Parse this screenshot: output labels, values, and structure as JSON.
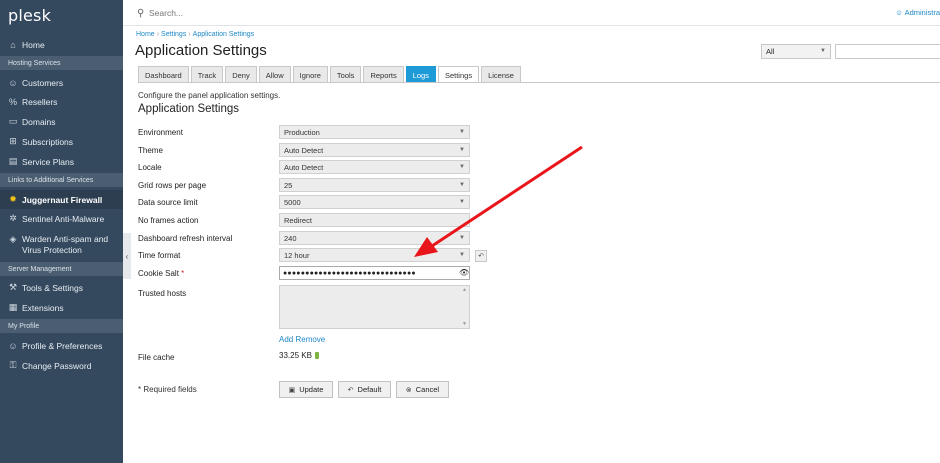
{
  "app": {
    "logo": "plesk"
  },
  "sidebar": {
    "items_top": [
      {
        "label": "Home",
        "icon": "home-icon"
      }
    ],
    "sections": [
      {
        "title": "Hosting Services"
      },
      {
        "title": "Links to Additional Services"
      },
      {
        "title": "Server Management"
      },
      {
        "title": "My Profile"
      }
    ],
    "hosting": [
      {
        "label": "Customers",
        "icon": "user-icon"
      },
      {
        "label": "Resellers",
        "icon": "percent-icon"
      },
      {
        "label": "Domains",
        "icon": "monitor-icon"
      },
      {
        "label": "Subscriptions",
        "icon": "grid-icon"
      },
      {
        "label": "Service Plans",
        "icon": "plans-icon"
      }
    ],
    "links": [
      {
        "label": "Juggernaut Firewall",
        "icon": "firewall-icon"
      },
      {
        "label": "Sentinel Anti-Malware",
        "icon": "gear-icon"
      },
      {
        "label": "Warden Anti-spam and Virus Protection",
        "icon": "shield-icon"
      }
    ],
    "server": [
      {
        "label": "Tools & Settings",
        "icon": "tools-icon"
      },
      {
        "label": "Extensions",
        "icon": "extensions-icon"
      }
    ],
    "profile": [
      {
        "label": "Profile & Preferences",
        "icon": "profile-icon"
      },
      {
        "label": "Change Password",
        "icon": "key-icon"
      }
    ]
  },
  "topbar": {
    "search_placeholder": "Search...",
    "user": "Administra"
  },
  "breadcrumb": [
    "Home",
    "Settings",
    "Application Settings"
  ],
  "page": {
    "title": "Application Settings",
    "filter": {
      "selected": "All"
    },
    "description": "Configure the panel application settings.",
    "section_title": "Application Settings"
  },
  "tabs": [
    "Dashboard",
    "Track",
    "Deny",
    "Allow",
    "Ignore",
    "Tools",
    "Reports",
    "Logs",
    "Settings",
    "License"
  ],
  "form": {
    "environment": {
      "label": "Environment",
      "value": "Production"
    },
    "theme": {
      "label": "Theme",
      "value": "Auto Detect"
    },
    "locale": {
      "label": "Locale",
      "value": "Auto Detect"
    },
    "grid_rows": {
      "label": "Grid rows per page",
      "value": "25"
    },
    "data_source_limit": {
      "label": "Data source limit",
      "value": "5000"
    },
    "no_frames_action": {
      "label": "No frames action",
      "value": "Redirect"
    },
    "dashboard_refresh": {
      "label": "Dashboard refresh interval",
      "value": "240"
    },
    "time_format": {
      "label": "Time format",
      "value": "12 hour"
    },
    "cookie_salt": {
      "label": "Cookie Salt",
      "required_mark": "*",
      "value": "●●●●●●●●●●●●●●●●●●●●●●●●●●●●●●"
    },
    "trusted_hosts": {
      "label": "Trusted hosts"
    },
    "add_link": "Add",
    "remove_link": "Remove",
    "file_cache": {
      "label": "File cache",
      "value": "33.25 KB"
    },
    "required_note": "* Required fields"
  },
  "buttons": {
    "update": "Update",
    "default": "Default",
    "cancel": "Cancel"
  },
  "colors": {
    "sidebar": "#34495e",
    "accent": "#1e9bd7",
    "arrow": "#e8161b"
  }
}
